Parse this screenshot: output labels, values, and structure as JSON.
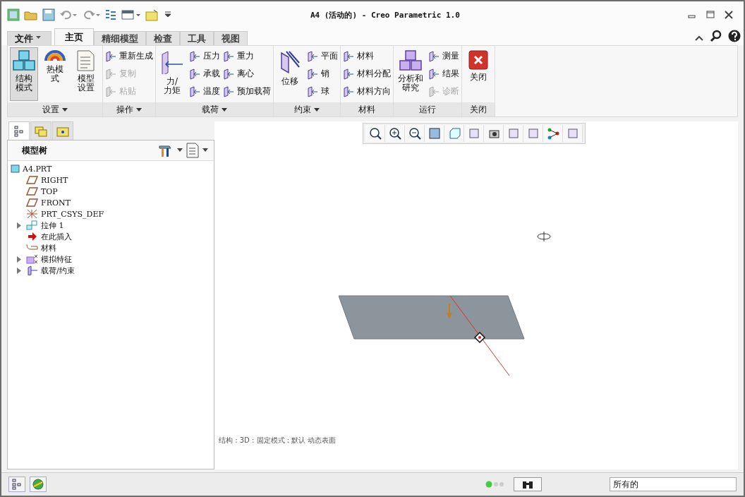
{
  "window": {
    "title": "A4 (活动的) - Creo Parametric 1.0"
  },
  "tabs": [
    {
      "label": "文件",
      "kind": "menu",
      "selected": false
    },
    {
      "label": "主页",
      "kind": "tab",
      "selected": true
    },
    {
      "label": "精细模型",
      "kind": "tab",
      "selected": false
    },
    {
      "label": "检查",
      "kind": "tab",
      "selected": false
    },
    {
      "label": "工具",
      "kind": "tab",
      "selected": false
    },
    {
      "label": "视图",
      "kind": "tab",
      "selected": false
    }
  ],
  "ribbon": {
    "groups": [
      {
        "label": "设置",
        "has_menu": true,
        "items": [
          {
            "label": "结构模式",
            "kind": "large",
            "selected": true,
            "disabled": false
          },
          {
            "label": "热模式",
            "kind": "large",
            "selected": false,
            "disabled": false
          },
          {
            "label": "模型设置",
            "kind": "large",
            "selected": false,
            "disabled": false
          }
        ]
      },
      {
        "label": "操作",
        "has_menu": true,
        "items": [
          {
            "label": "重新生成",
            "kind": "small",
            "disabled": false
          },
          {
            "label": "复制",
            "kind": "small",
            "disabled": true
          },
          {
            "label": "粘贴",
            "kind": "small",
            "disabled": true
          }
        ]
      },
      {
        "label": "载荷",
        "has_menu": true,
        "items": [
          {
            "label": "力/力矩",
            "kind": "large",
            "disabled": false
          },
          {
            "label": "压力",
            "kind": "small",
            "disabled": false
          },
          {
            "label": "承载",
            "kind": "small",
            "disabled": false
          },
          {
            "label": "温度",
            "kind": "small",
            "disabled": false
          },
          {
            "label": "重力",
            "kind": "small",
            "disabled": false
          },
          {
            "label": "离心",
            "kind": "small",
            "disabled": false
          },
          {
            "label": "预加载荷",
            "kind": "small",
            "disabled": false
          }
        ]
      },
      {
        "label": "约束",
        "has_menu": true,
        "items": [
          {
            "label": "位移",
            "kind": "large",
            "disabled": false
          },
          {
            "label": "平面",
            "kind": "small",
            "disabled": false
          },
          {
            "label": "销",
            "kind": "small",
            "disabled": false
          },
          {
            "label": "球",
            "kind": "small",
            "disabled": false
          }
        ]
      },
      {
        "label": "材料",
        "has_menu": false,
        "items": [
          {
            "label": "材料",
            "kind": "small",
            "disabled": false
          },
          {
            "label": "材料分配",
            "kind": "small",
            "disabled": false
          },
          {
            "label": "材料方向",
            "kind": "small",
            "disabled": false
          }
        ]
      },
      {
        "label": "运行",
        "has_menu": false,
        "items": [
          {
            "label": "分析和研究",
            "kind": "large",
            "disabled": false
          },
          {
            "label": "测量",
            "kind": "small",
            "disabled": false
          },
          {
            "label": "结果",
            "kind": "small",
            "disabled": false
          },
          {
            "label": "诊断",
            "kind": "small",
            "disabled": true
          }
        ]
      },
      {
        "label": "关闭",
        "has_menu": false,
        "items": [
          {
            "label": "关闭",
            "kind": "large",
            "disabled": false
          }
        ]
      }
    ]
  },
  "panel_tabs": [
    {
      "selected": true
    },
    {
      "selected": false
    },
    {
      "selected": false
    }
  ],
  "model_tree": {
    "title": "模型树",
    "items": [
      {
        "label": "A4.PRT",
        "kind": "part",
        "children": [
          {
            "label": "RIGHT",
            "kind": "plane",
            "expandable": false
          },
          {
            "label": "TOP",
            "kind": "plane",
            "expandable": false
          },
          {
            "label": "FRONT",
            "kind": "plane",
            "expandable": false
          },
          {
            "label": "PRT_CSYS_DEF",
            "kind": "csys",
            "expandable": false
          },
          {
            "label": "拉伸 1",
            "kind": "extrude",
            "expandable": true,
            "expanded": false
          },
          {
            "label": "在此插入",
            "kind": "insert",
            "expandable": false
          },
          {
            "label": "材料",
            "kind": "material",
            "expandable": false
          },
          {
            "label": "模拟特征",
            "kind": "simulation",
            "expandable": true,
            "expanded": false
          },
          {
            "label": "载荷/约束",
            "kind": "load",
            "expandable": true,
            "expanded": false
          }
        ]
      }
    ]
  },
  "viewport": {
    "status": "结构 : 3D : 固定模式 : 默认 动态表面"
  },
  "status_bar": {
    "filter": "所有的"
  }
}
